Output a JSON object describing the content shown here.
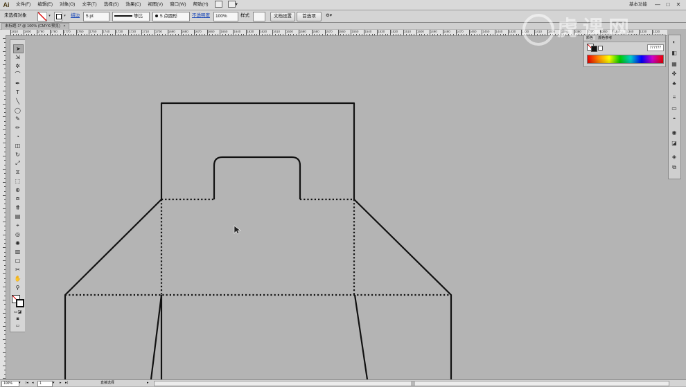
{
  "app": {
    "logo": "Ai"
  },
  "menu": [
    "文件(F)",
    "编辑(E)",
    "对象(O)",
    "文字(T)",
    "选择(S)",
    "效果(C)",
    "视图(V)",
    "窗口(W)",
    "帮助(H)"
  ],
  "workspace": "基本功能",
  "window_controls": {
    "minimize": "—",
    "maximize": "□",
    "close": "✕"
  },
  "control_bar": {
    "selection_status": "未选择对象",
    "stroke_label": "描边",
    "stroke_weight": "5 pt",
    "stroke_profile": "等比",
    "brush": "5 点圆形",
    "opacity_label": "不透明度",
    "opacity": "100%",
    "style_label": "样式",
    "doc_setup": "文档设置",
    "preferences": "首选项"
  },
  "document": {
    "tab_title": "未标题-1* @ 100% (CMYK/预览)"
  },
  "ruler": {
    "labels": [
      "1810",
      "1800",
      "1790",
      "1780",
      "1770",
      "1760",
      "1750",
      "1740",
      "1730",
      "1720",
      "1710",
      "1700",
      "1690",
      "1680",
      "1670",
      "1660",
      "1650",
      "1640",
      "1630",
      "1620",
      "1610",
      "1600",
      "1590",
      "1580",
      "1570",
      "1560",
      "1550",
      "1540",
      "1530",
      "1520",
      "1510",
      "1500",
      "1490",
      "1480",
      "1470",
      "1460",
      "1450",
      "1440",
      "1430",
      "1420",
      "1410",
      "1400",
      "1390",
      "1380",
      "1370",
      "1360",
      "1350",
      "1340",
      "1330",
      "1320"
    ]
  },
  "color_panel": {
    "title": "颜色",
    "tab2": "颜色参考",
    "hex": "777777"
  },
  "status": {
    "zoom": "100%",
    "page": "1",
    "mode": "直接选择"
  },
  "watermark": "虎课网",
  "colors": {
    "stroke": "#111111",
    "canvas": "#b4b4b4",
    "chrome": "#d4d4d4"
  },
  "tools": [
    "selection-tool-icon",
    "direct-selection-tool-icon",
    "magic-wand-icon",
    "lasso-icon",
    "pen-tool-icon",
    "type-tool-icon",
    "line-tool-icon",
    "ellipse-tool-icon",
    "paintbrush-icon",
    "pencil-icon",
    "blob-brush-icon",
    "eraser-icon",
    "rotate-icon",
    "scale-icon",
    "width-tool-icon",
    "free-transform-icon",
    "shape-builder-icon",
    "perspective-grid-icon",
    "mesh-icon",
    "gradient-icon",
    "eyedropper-icon",
    "blend-icon",
    "symbol-sprayer-icon",
    "column-graph-icon",
    "artboard-icon",
    "slice-icon",
    "hand-icon",
    "zoom-icon"
  ]
}
